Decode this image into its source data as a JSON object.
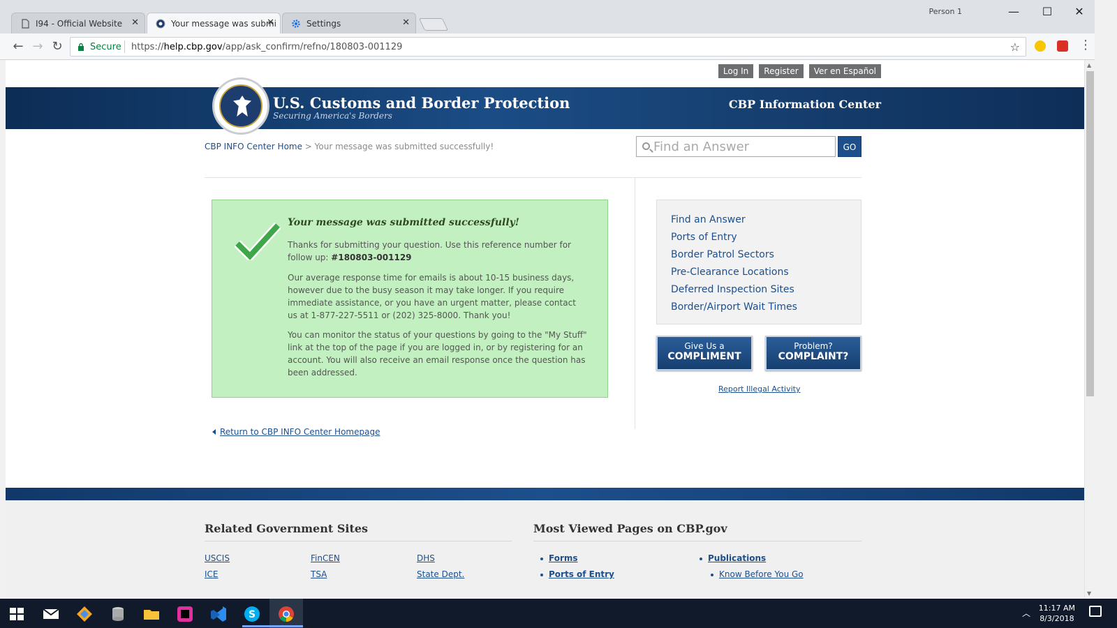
{
  "browser": {
    "tabs": [
      {
        "title": "I94 - Official Website"
      },
      {
        "title": "Your message was submi"
      },
      {
        "title": "Settings"
      }
    ],
    "profile": "Person 1",
    "secure_label": "Secure",
    "url_prefix": "https://",
    "url_domain": "help.cbp.gov",
    "url_path": "/app/ask_confirm/refno/180803-001129"
  },
  "top_links": [
    "Log In",
    "Register",
    "Ver en Español"
  ],
  "header": {
    "org_name": "U.S. Customs and Border Protection",
    "tagline": "Securing America's Borders",
    "center_title": "CBP Information Center"
  },
  "breadcrumb": {
    "home": "CBP INFO Center Home",
    "separator": " > ",
    "current": "Your message was submitted successfully!"
  },
  "search": {
    "placeholder": "Find an Answer",
    "go_label": "GO"
  },
  "success": {
    "title": "Your message was submitted successfully!",
    "p1_text": "Thanks for submitting your question. Use this reference number for follow up: ",
    "reference": "#180803-001129",
    "p2": "Our average response time for emails is about 10-15 business days, however due to the busy season it may take longer. If you require immediate assistance, or you have an urgent matter, please contact us at 1-877-227-5511 or (202) 325-8000. Thank you!",
    "p3": "You can monitor the status of your questions by going to the \"My Stuff\" link at the top of the page if you are logged in, or by registering for an account. You will also receive an email response once the question has been addressed."
  },
  "return_link": "Return to CBP INFO Center Homepage",
  "side_links": [
    "Find an Answer",
    "Ports of Entry",
    "Border Patrol Sectors",
    "Pre-Clearance Locations",
    "Deferred Inspection Sites",
    "Border/Airport Wait Times"
  ],
  "cta": {
    "compliment_small": "Give Us a",
    "compliment_big": "COMPLIMENT",
    "complaint_small": "Problem?",
    "complaint_big": "COMPLAINT?"
  },
  "report_link": "Report Illegal Activity",
  "footer": {
    "related_heading": "Related Government Sites",
    "related_links": [
      "USCIS",
      "FinCEN",
      "DHS",
      "ICE",
      "TSA",
      "State Dept."
    ],
    "viewed_heading": "Most Viewed Pages on CBP.gov",
    "viewed_links": [
      "Forms",
      "Publications",
      "Ports of Entry"
    ],
    "sub_link": "Know Before You Go"
  },
  "taskbar": {
    "time": "11:17 AM",
    "date": "8/3/2018"
  },
  "colors": {
    "accent_blue": "#1d4f8c",
    "success_bg": "#c3f0c0",
    "check_green": "#3fa64a"
  }
}
